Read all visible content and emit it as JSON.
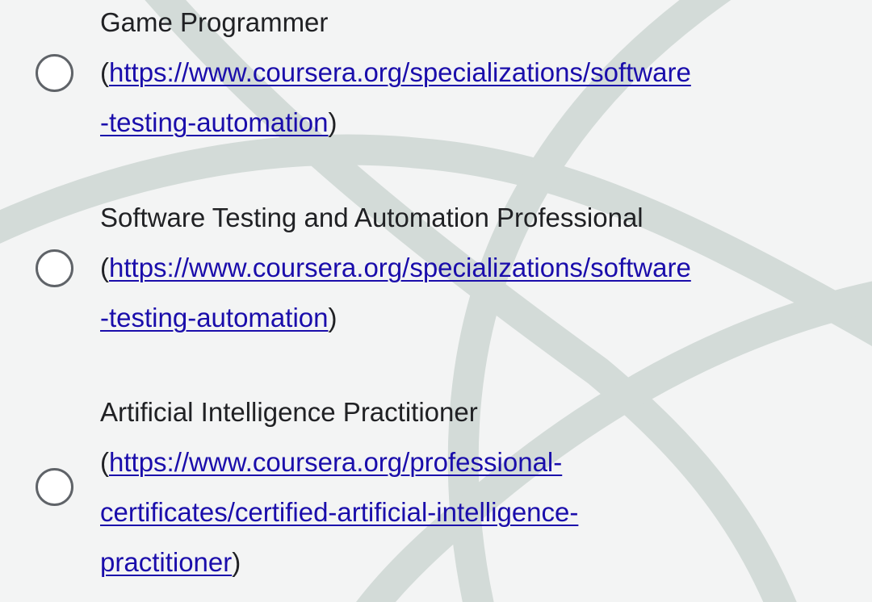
{
  "options": [
    {
      "title": "Game Programmer",
      "open_paren": "(",
      "close_paren": ")",
      "link_line1": "https://www.coursera.org/specializations/software",
      "link_line2": "-testing-automation",
      "selected": false
    },
    {
      "title": "Software Testing and Automation Professional",
      "open_paren": "(",
      "close_paren": ")",
      "link_line1": "https://www.coursera.org/specializations/software",
      "link_line2": "-testing-automation",
      "selected": false
    },
    {
      "title": "Artificial Intelligence Practitioner",
      "open_paren": "(",
      "close_paren": ")",
      "link_line1": "https://www.coursera.org/professional-",
      "link_line2": "certificates/certified-artificial-intelligence-",
      "link_line3": "practitioner",
      "selected": false
    }
  ],
  "colors": {
    "background": "#f3f4f4",
    "text": "#202124",
    "link": "#1a0dab",
    "radio_border": "#5f6368",
    "background_art": "#c9d3cf"
  }
}
